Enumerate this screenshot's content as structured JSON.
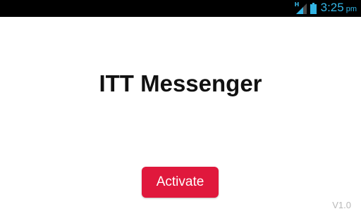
{
  "status_bar": {
    "network_type": "H",
    "time": "3:25",
    "ampm": "pm",
    "icons": [
      "network-type-icon",
      "signal-icon",
      "battery-icon"
    ],
    "accent_color": "#33b5e5"
  },
  "app": {
    "title": "ITT Messenger",
    "activate_label": "Activate",
    "version": "V1.0",
    "button_color": "#e0183c"
  }
}
